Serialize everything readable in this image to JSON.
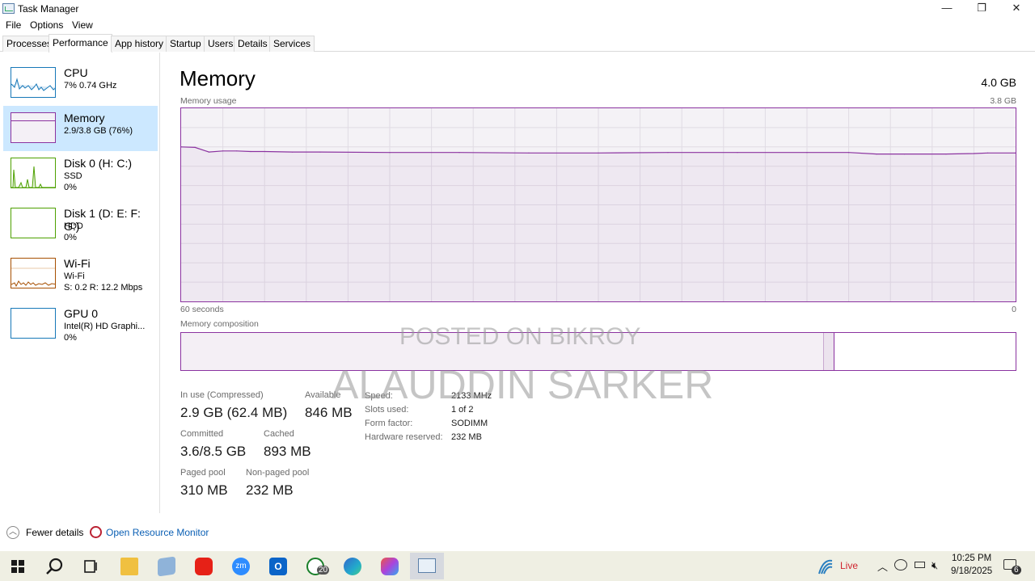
{
  "window": {
    "title": "Task Manager",
    "minimize_glyph": "—",
    "restore_glyph": "❐",
    "close_glyph": "✕"
  },
  "menu": {
    "file": "File",
    "options": "Options",
    "view": "View"
  },
  "tabs": [
    "Processes",
    "Performance",
    "App history",
    "Startup",
    "Users",
    "Details",
    "Services"
  ],
  "active_tab": "Performance",
  "sidebar": {
    "items": [
      {
        "title": "CPU",
        "line1": "7% 0.74 GHz",
        "line2": "",
        "color": "#1778b8"
      },
      {
        "title": "Memory",
        "line1": "2.9/3.8 GB (76%)",
        "line2": "",
        "color": "#8b33a0"
      },
      {
        "title": "Disk 0 (H: C:)",
        "line1": "SSD",
        "line2": "0%",
        "color": "#4da000"
      },
      {
        "title": "Disk 1 (D: E: F: G:)",
        "line1": "HDD",
        "line2": "0%",
        "color": "#4da000"
      },
      {
        "title": "Wi-Fi",
        "line1": "Wi-Fi",
        "line2": "S: 0.2  R: 12.2 Mbps",
        "color": "#a74f01"
      },
      {
        "title": "GPU 0",
        "line1": "Intel(R) HD Graphi...",
        "line2": "0%",
        "color": "#1778b8"
      }
    ]
  },
  "main": {
    "title": "Memory",
    "total": "4.0 GB",
    "usage_label": "Memory usage",
    "usage_max": "3.8 GB",
    "time_label": "60 seconds",
    "time_end": "0",
    "composition_label": "Memory composition",
    "in_use_fraction": 0.77,
    "modified_fraction": 0.013,
    "stats": {
      "in_use_label": "In use (Compressed)",
      "in_use_value": "2.9 GB (62.4 MB)",
      "available_label": "Available",
      "available_value": "846 MB",
      "committed_label": "Committed",
      "committed_value": "3.6/8.5 GB",
      "cached_label": "Cached",
      "cached_value": "893 MB",
      "paged_label": "Paged pool",
      "paged_value": "310 MB",
      "nonpaged_label": "Non-paged pool",
      "nonpaged_value": "232 MB"
    },
    "details": {
      "speed_label": "Speed:",
      "speed_value": "2133 MHz",
      "slots_label": "Slots used:",
      "slots_value": "1 of 2",
      "form_label": "Form factor:",
      "form_value": "SODIMM",
      "reserved_label": "Hardware reserved:",
      "reserved_value": "232 MB"
    }
  },
  "watermark": {
    "line1": "POSTED ON BIKROY",
    "line2": "ALAUDDIN SARKER"
  },
  "footer": {
    "fewer_details": "Fewer details",
    "open_monitor": "Open Resource Monitor"
  },
  "taskbar": {
    "weather": "Live",
    "time": "10:25 PM",
    "date": "9/18/2025",
    "whatsapp_badge": "20",
    "notification_count": "6"
  },
  "chart_data": {
    "type": "area",
    "title": "Memory usage",
    "xlabel": "60 seconds",
    "ylabel": "",
    "xlim": [
      60,
      0
    ],
    "ylim": [
      0,
      3.8
    ],
    "x": [
      60,
      59,
      58,
      57,
      56,
      55,
      54,
      52,
      50,
      45,
      40,
      35,
      30,
      25,
      20,
      15,
      12,
      10,
      8,
      5,
      3,
      2,
      0
    ],
    "series": [
      {
        "values": [
          3.04,
          3.03,
          2.94,
          2.96,
          2.96,
          2.95,
          2.95,
          2.94,
          2.94,
          2.93,
          2.93,
          2.92,
          2.92,
          2.93,
          2.93,
          2.93,
          2.93,
          2.9,
          2.9,
          2.9,
          2.91,
          2.92,
          2.92
        ]
      }
    ],
    "grid": true,
    "color": "#8b33a0"
  }
}
